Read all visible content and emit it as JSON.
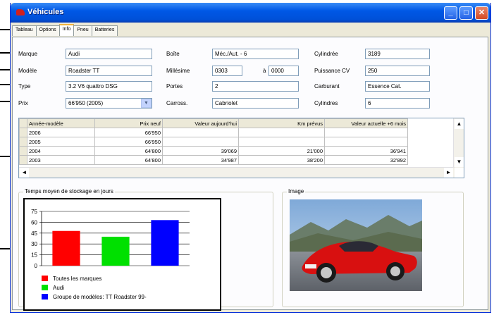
{
  "window": {
    "title": "Véhicules"
  },
  "tabs": [
    "Tableau",
    "Options",
    "Info",
    "Pneu",
    "Batteries"
  ],
  "form": {
    "marque_label": "Marque",
    "marque": "Audi",
    "modele_label": "Modèle",
    "modele": "Roadster TT",
    "type_label": "Type",
    "type": "3.2 V6 quattro DSG",
    "prix_label": "Prix",
    "prix": "66'950 (2005)",
    "boite_label": "Boîte",
    "boite": "Méc./Aut. - 6",
    "millesime_label": "Millésime",
    "millesime_from": "0303",
    "a_label": "à",
    "millesime_to": "0000",
    "portes_label": "Portes",
    "portes": "2",
    "carross_label": "Carross.",
    "carross": "Cabriolet",
    "cylindree_label": "Cylindrée",
    "cylindree": "3189",
    "puissance_label": "Puissance CV",
    "puissance": "250",
    "carburant_label": "Carburant",
    "carburant": "Essence Cat.",
    "cylindres_label": "Cylindres",
    "cylindres": "6"
  },
  "table": {
    "headers": [
      "Année-modèle",
      "Prix neuf",
      "Valeur aujourd'hui",
      "Km prévus",
      "Valeur actuelle +6 mois"
    ],
    "rows": [
      [
        "2006",
        "66'950",
        "",
        "",
        ""
      ],
      [
        "2005",
        "66'950",
        "",
        "",
        ""
      ],
      [
        "2004",
        "64'800",
        "39'069",
        "21'000",
        "36'941"
      ],
      [
        "2003",
        "64'800",
        "34'987",
        "38'200",
        "32'892"
      ]
    ]
  },
  "stock_group": {
    "title": "Temps moyen de stockage en jours"
  },
  "image_group": {
    "title": "Image"
  },
  "chart_data": {
    "type": "bar",
    "title": "Temps moyen de stockage en jours",
    "categories": [
      "Toutes les marques",
      "Audi",
      "Groupe de modèles: TT Roadster 99-"
    ],
    "values": [
      48,
      40,
      63
    ],
    "colors": [
      "#ff0000",
      "#00e000",
      "#0000ff"
    ],
    "ylim": [
      0,
      75
    ],
    "yticks": [
      "75",
      "60",
      "45",
      "30",
      "15",
      "0"
    ],
    "legend": [
      "Toutes les marques",
      "Audi",
      "Groupe de modèles: TT Roadster 99-"
    ]
  },
  "icons": {
    "dropdown": "▼",
    "scroll_up": "▲",
    "scroll_down": "▼",
    "scroll_left": "◄",
    "scroll_right": "►",
    "minimize": "_",
    "maximize": "□",
    "close": "✕"
  }
}
